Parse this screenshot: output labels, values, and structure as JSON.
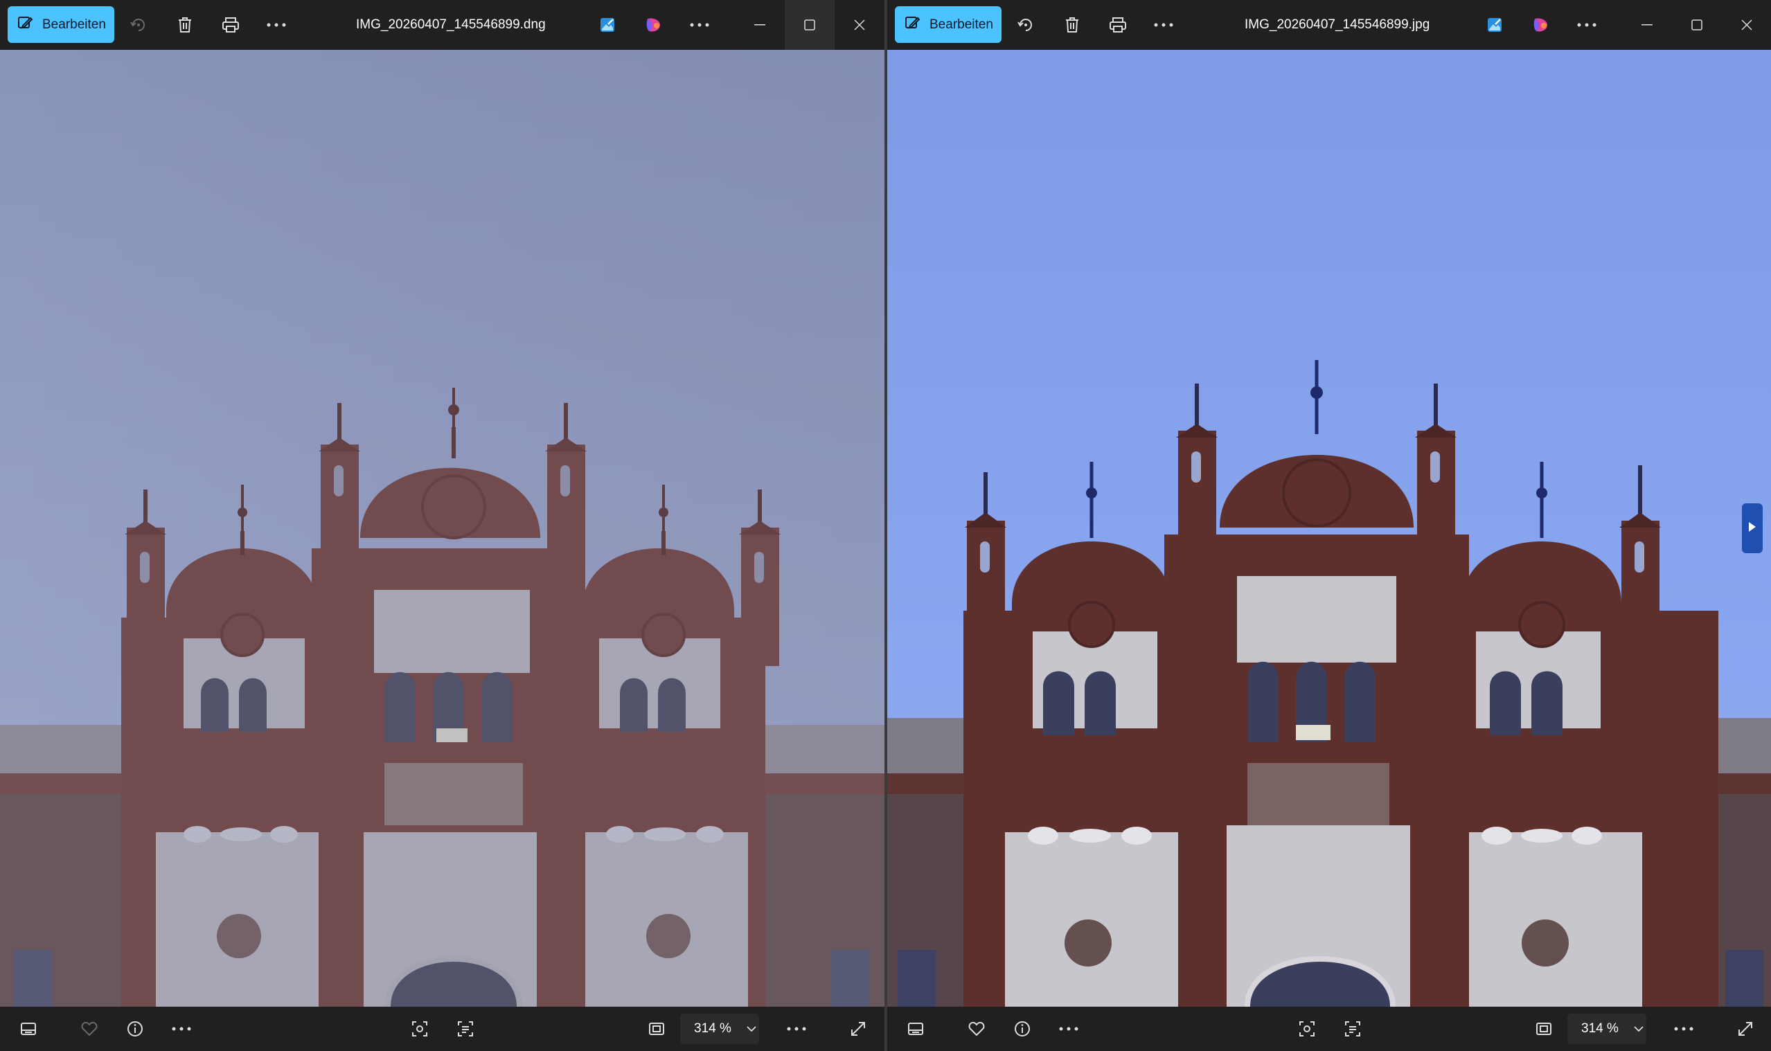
{
  "left_viewer": {
    "edit_label": "Bearbeiten",
    "filename": "IMG_20260407_145546899.dng",
    "zoom_value": "314 %"
  },
  "right_viewer": {
    "edit_label": "Bearbeiten",
    "filename": "IMG_20260407_145546899.jpg",
    "zoom_value": "314 %"
  },
  "icons": {
    "toolbar": [
      "edit-icon",
      "rotate-icon",
      "delete-icon",
      "print-icon",
      "more-icon",
      "edit-image-icon",
      "ai-copilot-icon",
      "more-icon"
    ],
    "window": [
      "minimize-icon",
      "maximize-icon",
      "close-icon"
    ],
    "bottom": [
      "filmstrip-icon",
      "favorite-icon",
      "info-icon",
      "more-icon",
      "visual-search-icon",
      "text-scan-icon",
      "fit-screen-icon",
      "chevron-down-icon",
      "more-icon",
      "fullscreen-icon"
    ]
  },
  "colors": {
    "accent": "#4cc2ff",
    "titlebar": "#202020",
    "sky_dng": "#8c97bf",
    "sky_jpg": "#86a4ee",
    "brick_dng": "#6d3b37",
    "brick_jpg": "#5b2f2c"
  }
}
